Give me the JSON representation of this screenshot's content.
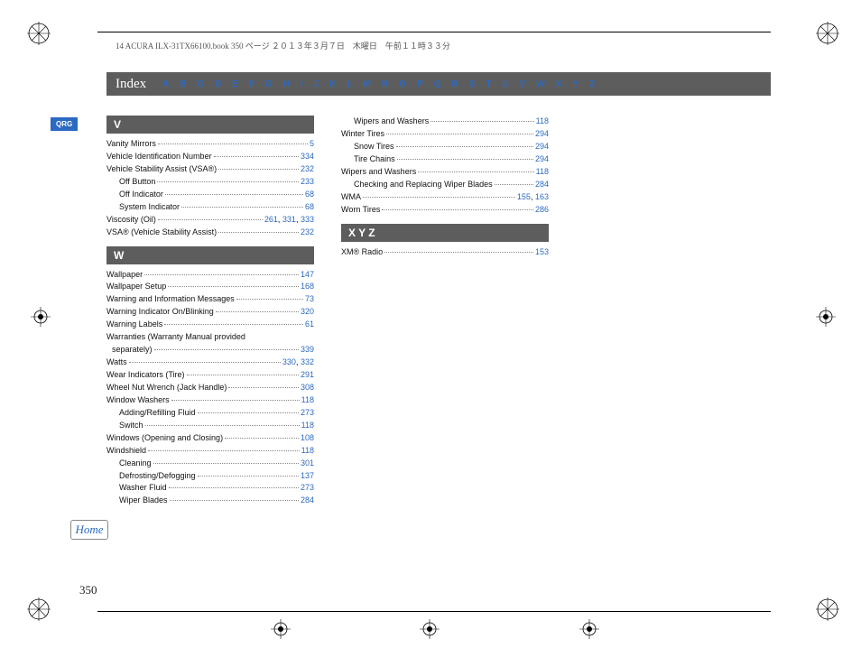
{
  "header_line": "14 ACURA ILX-31TX66100.book  350 ページ  ２０１３年３月７日　木曜日　午前１１時３３分",
  "index_title": "Index",
  "alpha": [
    "A",
    "B",
    "C",
    "D",
    "E",
    "F",
    "G",
    "H",
    "I",
    "J",
    "K",
    "L",
    "M",
    "N",
    "O",
    "P",
    "Q",
    "R",
    "S",
    "T",
    "U",
    "V",
    "W",
    "X",
    "Y",
    "Z"
  ],
  "qrg_label": "QRG",
  "home_label": "Home",
  "page_number": "350",
  "sections": {
    "V": {
      "title": "V",
      "entries": [
        {
          "label": "Vanity Mirrors",
          "pages": [
            "5"
          ],
          "sub": false
        },
        {
          "label": "Vehicle Identification Number",
          "pages": [
            "334"
          ],
          "sub": false
        },
        {
          "label": "Vehicle Stability Assist (VSA®)",
          "pages": [
            "232"
          ],
          "sub": false
        },
        {
          "label": "Off Button",
          "pages": [
            "233"
          ],
          "sub": true
        },
        {
          "label": "Off Indicator",
          "pages": [
            "68"
          ],
          "sub": true
        },
        {
          "label": "System Indicator",
          "pages": [
            "68"
          ],
          "sub": true
        },
        {
          "label": "Viscosity (Oil)",
          "pages": [
            "261",
            "331",
            "333"
          ],
          "sub": false
        },
        {
          "label": "VSA® (Vehicle Stability Assist)",
          "pages": [
            "232"
          ],
          "sub": false
        }
      ]
    },
    "W": {
      "title": "W",
      "entries": [
        {
          "label": "Wallpaper",
          "pages": [
            "147"
          ],
          "sub": false
        },
        {
          "label": "Wallpaper Setup",
          "pages": [
            "168"
          ],
          "sub": false
        },
        {
          "label": "Warning and Information Messages",
          "pages": [
            "73"
          ],
          "sub": false
        },
        {
          "label": "Warning Indicator On/Blinking",
          "pages": [
            "320"
          ],
          "sub": false
        },
        {
          "label": "Warning Labels",
          "pages": [
            "61"
          ],
          "sub": false
        },
        {
          "label": "Warranties (Warranty Manual provided separately)",
          "pages": [
            "339"
          ],
          "sub": false,
          "wrap": true
        },
        {
          "label": "Watts",
          "pages": [
            "330",
            "332"
          ],
          "sub": false
        },
        {
          "label": "Wear Indicators (Tire)",
          "pages": [
            "291"
          ],
          "sub": false
        },
        {
          "label": "Wheel Nut Wrench (Jack Handle)",
          "pages": [
            "308"
          ],
          "sub": false
        },
        {
          "label": "Window Washers",
          "pages": [
            "118"
          ],
          "sub": false
        },
        {
          "label": "Adding/Refilling Fluid",
          "pages": [
            "273"
          ],
          "sub": true
        },
        {
          "label": "Switch",
          "pages": [
            "118"
          ],
          "sub": true
        },
        {
          "label": "Windows (Opening and Closing)",
          "pages": [
            "108"
          ],
          "sub": false
        },
        {
          "label": "Windshield",
          "pages": [
            "118"
          ],
          "sub": false
        },
        {
          "label": "Cleaning",
          "pages": [
            "301"
          ],
          "sub": true
        },
        {
          "label": "Defrosting/Defogging",
          "pages": [
            "137"
          ],
          "sub": true
        },
        {
          "label": "Washer Fluid",
          "pages": [
            "273"
          ],
          "sub": true
        },
        {
          "label": "Wiper Blades",
          "pages": [
            "284"
          ],
          "sub": true
        }
      ]
    },
    "W2": {
      "entries": [
        {
          "label": "Wipers and Washers",
          "pages": [
            "118"
          ],
          "sub": true
        },
        {
          "label": "Winter Tires",
          "pages": [
            "294"
          ],
          "sub": false
        },
        {
          "label": "Snow Tires",
          "pages": [
            "294"
          ],
          "sub": true
        },
        {
          "label": "Tire Chains",
          "pages": [
            "294"
          ],
          "sub": true
        },
        {
          "label": "Wipers and Washers",
          "pages": [
            "118"
          ],
          "sub": false
        },
        {
          "label": "Checking and Replacing Wiper Blades",
          "pages": [
            "284"
          ],
          "sub": true
        },
        {
          "label": "WMA",
          "pages": [
            "155",
            "163"
          ],
          "sub": false
        },
        {
          "label": "Worn Tires",
          "pages": [
            "286"
          ],
          "sub": false
        }
      ]
    },
    "XYZ": {
      "title": "X    Y    Z",
      "entries": [
        {
          "label": "XM® Radio",
          "pages": [
            "153"
          ],
          "sub": false
        }
      ]
    }
  }
}
